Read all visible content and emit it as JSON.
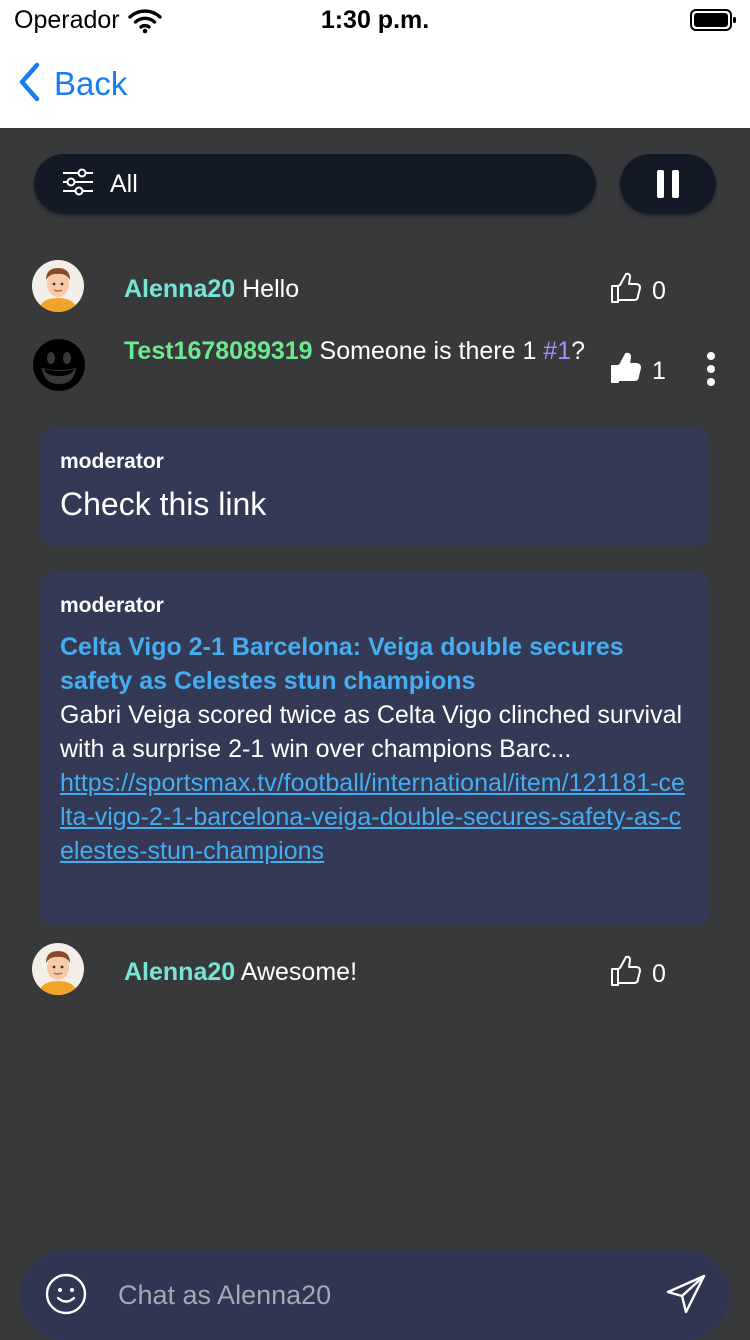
{
  "status": {
    "carrier": "Operador",
    "time": "1:30 p.m."
  },
  "nav": {
    "back_label": "Back"
  },
  "filter": {
    "label": "All"
  },
  "messages": [
    {
      "user": "Alenna20",
      "text": "Hello",
      "likes": "0"
    },
    {
      "user": "Test1678089319",
      "text_before": "Someone is there 1",
      "hashtag": "#1",
      "text_after": "?",
      "likes": "1"
    },
    {
      "user": "Alenna20",
      "text": "Awesome!",
      "likes": "0"
    }
  ],
  "moderator_cards": [
    {
      "author": "moderator",
      "text": "Check this link"
    },
    {
      "author": "moderator",
      "title": "Celta Vigo 2-1 Barcelona: Veiga double secures safety as Celestes stun champions",
      "description": "Gabri Veiga scored twice as Celta Vigo clinched survival with a surprise 2-1 win over champions Barc...",
      "link": "https://sportsmax.tv/football/international/item/121181-celta-vigo-2-1-barcelona-veiga-double-secures-safety-as-celestes-stun-champions"
    }
  ],
  "composer": {
    "placeholder": "Chat as Alenna20"
  },
  "colors": {
    "background": "#38393b",
    "accent_blue": "#1a7cf3",
    "link_blue": "#45adf0",
    "name_teal": "#78e4d8",
    "name_green": "#6ee88e",
    "card_bg": "#343955"
  },
  "icons": {
    "wifi": "wifi-icon",
    "battery": "battery-icon",
    "back": "chevron-left-icon",
    "filter": "sliders-icon",
    "pause": "pause-icon",
    "like": "thumbs-up-icon",
    "more": "more-vertical-icon",
    "emoji": "smiley-icon",
    "send": "paper-plane-icon"
  }
}
